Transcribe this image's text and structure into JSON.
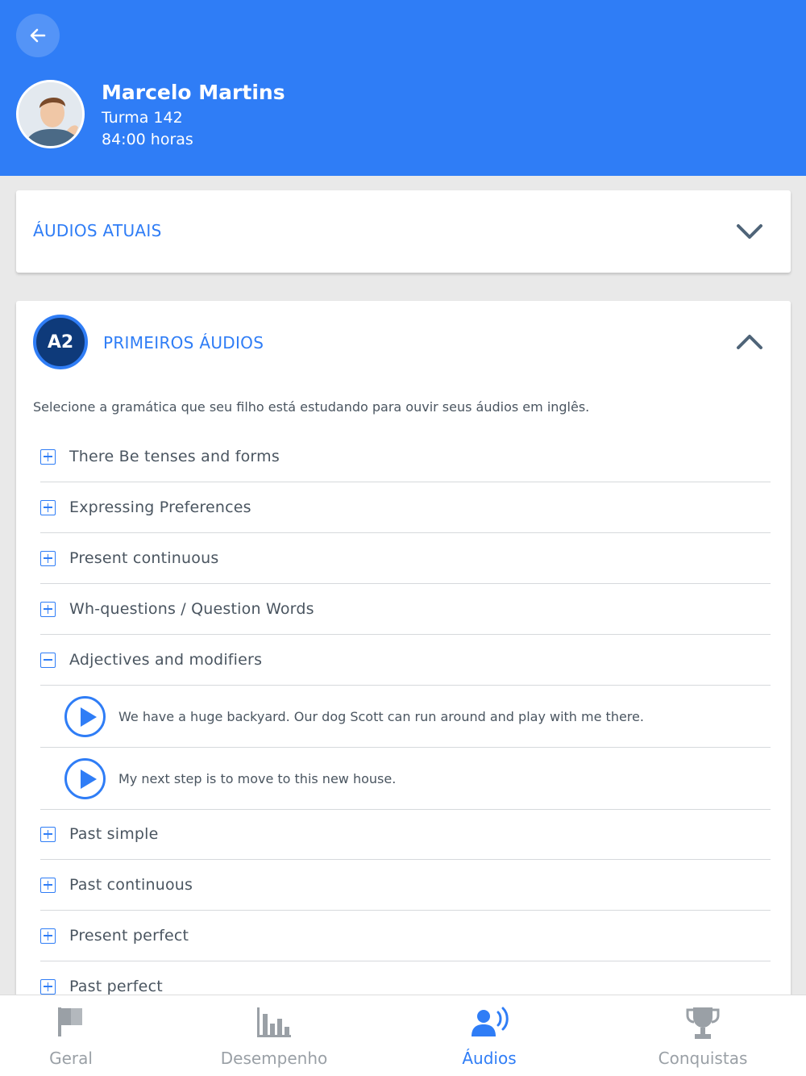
{
  "header": {
    "user_name": "Marcelo Martins",
    "class_label": "Turma 142",
    "hours_label": "84:00 horas"
  },
  "current_audios": {
    "title": "ÁUDIOS ATUAIS"
  },
  "first_audios": {
    "level": "A2",
    "title": "PRIMEIROS ÁUDIOS",
    "instructions": "Selecione a gramática que seu filho está estudando para ouvir seus áudios em inglês.",
    "topics": [
      {
        "label": "There Be tenses and forms",
        "expanded": false
      },
      {
        "label": "Expressing Preferences",
        "expanded": false
      },
      {
        "label": "Present continuous",
        "expanded": false
      },
      {
        "label": "Wh-questions / Question Words",
        "expanded": false
      },
      {
        "label": "Adjectives and modifiers",
        "expanded": true
      },
      {
        "label": "Past simple",
        "expanded": false
      },
      {
        "label": "Past continuous",
        "expanded": false
      },
      {
        "label": "Present perfect",
        "expanded": false
      },
      {
        "label": "Past perfect",
        "expanded": false
      }
    ],
    "audios": [
      "We have a huge backyard. Our dog Scott can run around and play with me there.",
      "My next step is to move to this new house."
    ]
  },
  "nav": {
    "items": [
      {
        "label": "Geral",
        "icon": "flag-icon",
        "active": false
      },
      {
        "label": "Desempenho",
        "icon": "bar-chart-icon",
        "active": false
      },
      {
        "label": "Áudios",
        "icon": "audio-user-icon",
        "active": true
      },
      {
        "label": "Conquistas",
        "icon": "trophy-icon",
        "active": false
      }
    ]
  },
  "colors": {
    "primary": "#2f7df6",
    "badge_dark": "#0e3a7a",
    "text": "#4a5560",
    "inactive": "#9aa0a6"
  }
}
